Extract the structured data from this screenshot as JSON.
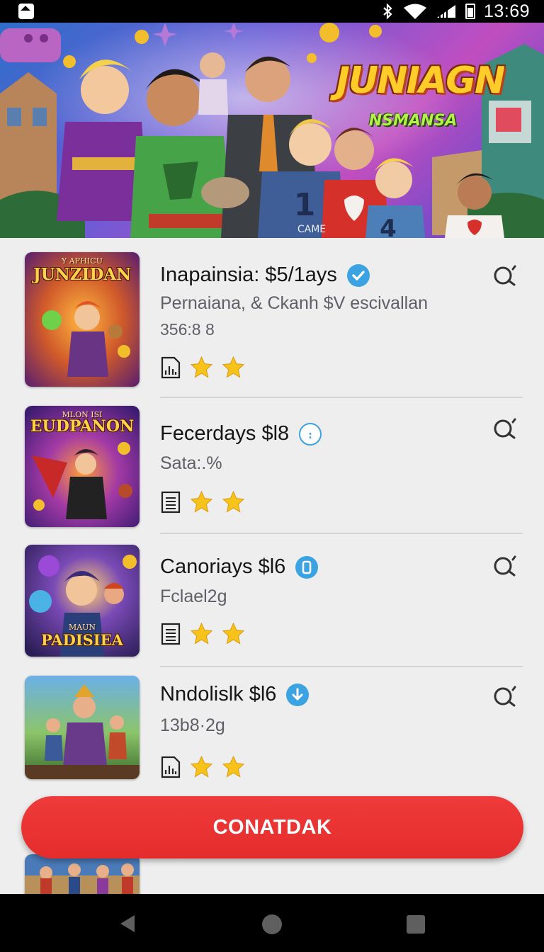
{
  "status_bar": {
    "time": "13:69",
    "icons": [
      "app-notification-icon",
      "bluetooth-icon",
      "wifi-icon",
      "signal-icon",
      "battery-icon"
    ]
  },
  "hero": {
    "title": "JUNIAGN",
    "subtitle": "NSMANSA",
    "shirt_number": "1",
    "shirt_number_2": "4",
    "shirt_text": "CAME"
  },
  "items": [
    {
      "title": "Inapainsia:  $5/1ays",
      "subtitle": "Pernaiana, &  Ckanh $V escivallan",
      "meta": "356:8 8",
      "badge": "verified-check-icon",
      "thumb_title": "JUNZIDAN",
      "thumb_top": "Y AFHICU",
      "rating_stars": 2
    },
    {
      "title": "Fecerdays $l8",
      "subtitle": "Sata:.%",
      "meta": "",
      "badge": "info-outline-icon",
      "thumb_title": "EUDPANON",
      "thumb_top": "MLON ISI",
      "rating_stars": 2
    },
    {
      "title": "Canoriays $l6",
      "subtitle": "Fclael2g",
      "meta": "",
      "badge": "device-icon",
      "thumb_title": "PADISIEA",
      "thumb_top": "MAUN",
      "rating_stars": 2
    },
    {
      "title": "Nndolislk $l6",
      "subtitle": "13b8·2g",
      "meta": "",
      "badge": "download-arrow-icon",
      "thumb_title": "",
      "thumb_top": "",
      "rating_stars": 2
    }
  ],
  "cta": {
    "label": "CONATDAK"
  },
  "nav_bar": {
    "icons": [
      "back-icon",
      "home-icon",
      "recents-icon"
    ]
  },
  "colors": {
    "accent_red": "#e52c2c",
    "badge_blue": "#3ba3e2",
    "star_gold": "#f7c21a",
    "panel_bg": "#eeeeef"
  }
}
